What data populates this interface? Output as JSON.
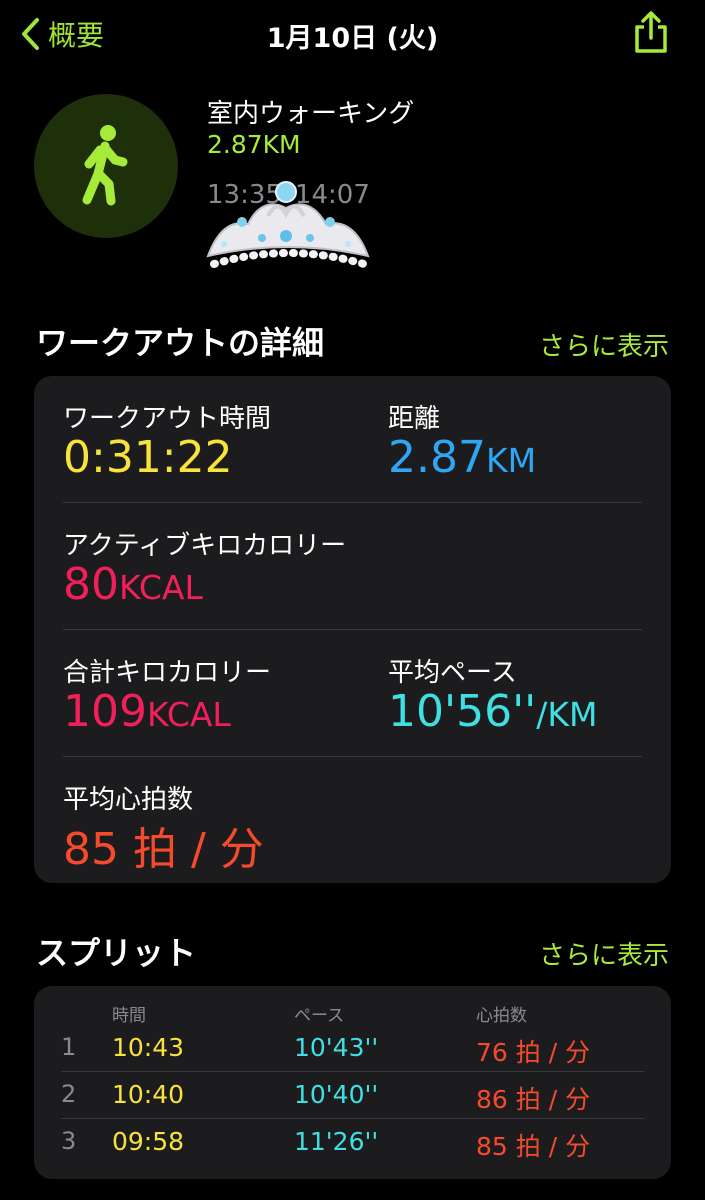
{
  "nav": {
    "back_label": "概要",
    "title": "1月10日 (火)"
  },
  "activity": {
    "name": "室内ウォーキング",
    "distance": "2.87KM",
    "time_range": "13:35–14:07"
  },
  "details": {
    "title": "ワークアウトの詳細",
    "more": "さらに表示",
    "workout_time": {
      "label": "ワークアウト時間",
      "value": "0:31:22"
    },
    "distance": {
      "label": "距離",
      "value": "2.87",
      "unit": "KM"
    },
    "active_kcal": {
      "label": "アクティブキロカロリー",
      "value": "80",
      "unit": "KCAL"
    },
    "total_kcal": {
      "label": "合計キロカロリー",
      "value": "109",
      "unit": "KCAL"
    },
    "avg_pace": {
      "label": "平均ペース",
      "value": "10'56''",
      "unit": "/KM"
    },
    "avg_hr": {
      "label": "平均心拍数",
      "value": "85 拍 / 分"
    }
  },
  "splits": {
    "title": "スプリット",
    "more": "さらに表示",
    "headers": {
      "time": "時間",
      "pace": "ペース",
      "hr": "心拍数"
    },
    "rows": [
      {
        "idx": "1",
        "time": "10:43",
        "pace": "10'43''",
        "hr": "76 拍 / 分"
      },
      {
        "idx": "2",
        "time": "10:40",
        "pace": "10'40''",
        "hr": "86 拍 / 分"
      },
      {
        "idx": "3",
        "time": "09:58",
        "pace": "11'26''",
        "hr": "85 拍 / 分"
      }
    ]
  },
  "colors": {
    "accent": "#a6eb3a",
    "time": "#f7e33a",
    "distance": "#2ea6f4",
    "calories": "#f1205a",
    "pace": "#3ee0e3",
    "heart": "#f54b2c"
  }
}
